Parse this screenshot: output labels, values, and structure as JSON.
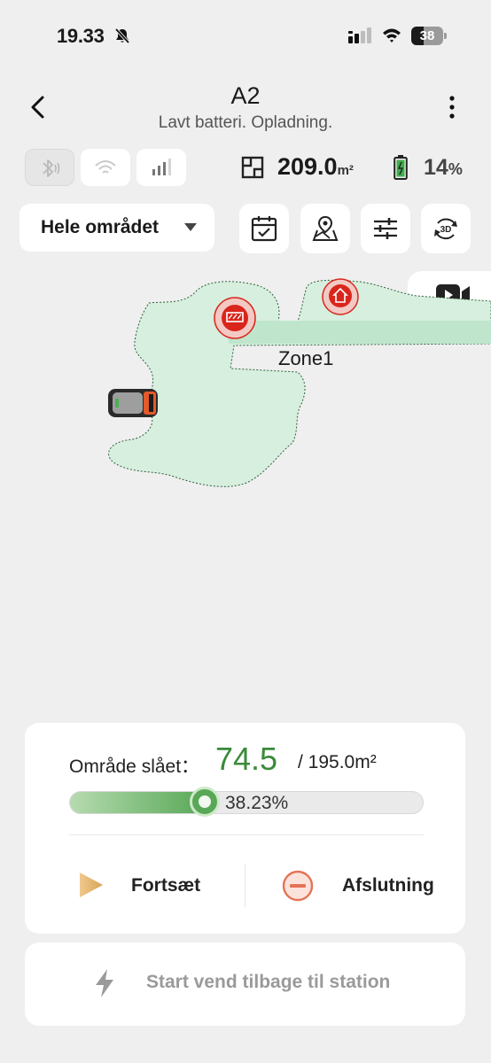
{
  "status_bar": {
    "time": "19.33",
    "battery_level": 38,
    "battery_text": "38"
  },
  "header": {
    "title": "A2",
    "subtitle": "Lavt batteri. Opladning."
  },
  "connectivity": {
    "bluetooth": "bluetooth-icon",
    "wifi": "wifi-icon",
    "cellular": "cellular-signal-icon"
  },
  "stats": {
    "area_value": "209.0",
    "area_unit": "m²",
    "battery_value": "14",
    "battery_unit": "%"
  },
  "zone_selector": {
    "label": "Hele området"
  },
  "toolbar": {
    "schedule": "calendar-check-icon",
    "map": "map-pin-icon",
    "settings": "sliders-icon",
    "view_3d": "3D"
  },
  "map": {
    "zone_label": "Zone1",
    "colors": {
      "lawn": "#d7efdf",
      "path": "#bfe6cd",
      "marker": "#d9261c"
    }
  },
  "progress": {
    "label": "Område slået：",
    "mowed_value": "74.5",
    "total": "/ 195.0m²",
    "percent_text": "38.23%",
    "percent": 38.23
  },
  "actions": {
    "resume_label": "Fortsæt",
    "end_label": "Afslutning"
  },
  "return": {
    "label": "Start vend tilbage til station"
  },
  "colors": {
    "accent_green": "#3a8a3a",
    "end_orange": "#e57356",
    "play_gold": "#e0b474"
  }
}
